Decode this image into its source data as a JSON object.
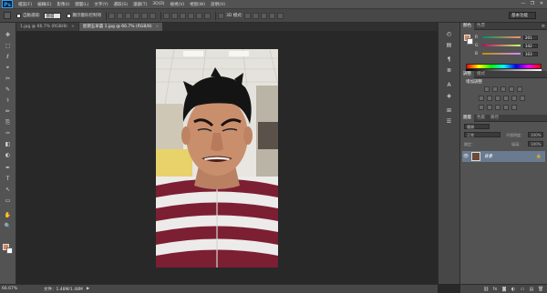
{
  "menubar": {
    "logo": "Ps",
    "items": [
      "檔案(F)",
      "編輯(E)",
      "影像(I)",
      "圖層(L)",
      "文字(Y)",
      "選取(S)",
      "濾鏡(T)",
      "3D(D)",
      "檢視(V)",
      "視窗(W)",
      "說明(H)"
    ],
    "window_controls": [
      "—",
      "❐",
      "✕"
    ]
  },
  "options": {
    "auto_select_label": "自動選取:",
    "auto_select_value": "圖層",
    "show_transform_label": "顯示變形控制項",
    "mode_3d_label": "3D 模式:",
    "workspace": "基本功能"
  },
  "tabs": [
    {
      "label": "1.jpg @ 66.7% (RGB/8)",
      "close": "×"
    },
    {
      "label": "星期五早晨 1.jpg @ 66.7% (RGB/8)",
      "close": "×"
    }
  ],
  "toolbox": {
    "tools": [
      "✥",
      "⬚",
      "ℓ",
      "⌖",
      "✂",
      "✎",
      "⚕",
      "✏",
      "⎘",
      "✑",
      "◧",
      "◐",
      "✒",
      "T",
      "↖",
      "▭",
      "✋",
      "🔍"
    ],
    "fg_color": "#d8845e",
    "bg_color": "#ffffff"
  },
  "status": {
    "zoom": "66.67%",
    "doc": "文件：1.48M/1.48M",
    "arrow": "▶"
  },
  "color_panel": {
    "tabs": [
      "顏色",
      "色票"
    ],
    "channels": [
      {
        "label": "R",
        "value": "201"
      },
      {
        "label": "G",
        "value": "142"
      },
      {
        "label": "B",
        "value": "103"
      }
    ],
    "menu": "≡"
  },
  "adjustments_panel": {
    "tabs": [
      "調整",
      "樣式"
    ],
    "title": "增加調整"
  },
  "layers_panel": {
    "tabs": [
      "圖層",
      "色版",
      "路徑"
    ],
    "kind_label": "種類",
    "blend_mode": "正常",
    "opacity_label": "不透明度：",
    "opacity_value": "100%",
    "lock_label": "鎖定：",
    "fill_label": "填滿：",
    "fill_value": "100%",
    "layer_name": "背景",
    "layer_eye": "👁",
    "layer_lock": "🔒",
    "footer_icons": [
      "⛓",
      "fx",
      "◙",
      "◐",
      "▭",
      "▤",
      "🗑"
    ]
  },
  "iconstrip": {
    "icons": [
      "◴",
      "▤",
      "¶",
      "≣",
      "A",
      "◈",
      "⊞",
      "☰"
    ]
  }
}
